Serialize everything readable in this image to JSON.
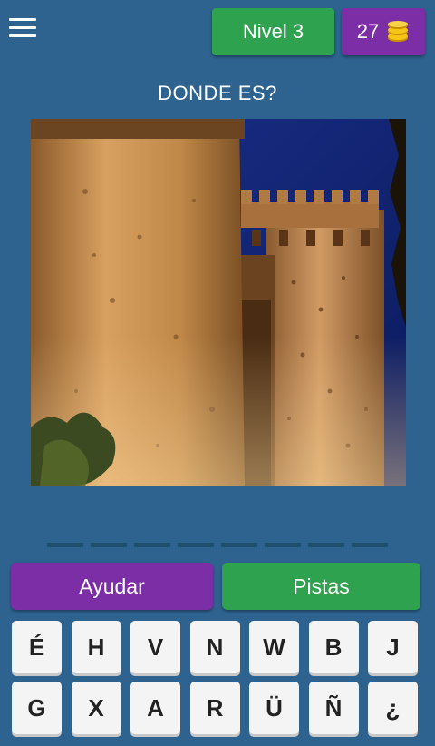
{
  "header": {
    "level_label": "Nivel 3",
    "coins": "27",
    "menu_icon": "hamburger-menu-icon",
    "coin_icon": "coin-stack-icon",
    "level_color": "#2ea24e",
    "coins_color": "#7b2ea6"
  },
  "question": "DONDE ES?",
  "answer_slots": 8,
  "actions": {
    "help_label": "Ayudar",
    "hints_label": "Pistas"
  },
  "keyboard": {
    "rows": [
      [
        "É",
        "H",
        "V",
        "N",
        "W",
        "B",
        "J"
      ],
      [
        "G",
        "X",
        "A",
        "R",
        "Ü",
        "Ñ",
        "¿"
      ]
    ]
  },
  "colors": {
    "background": "#2e6390",
    "key": "#f4f4f4"
  }
}
